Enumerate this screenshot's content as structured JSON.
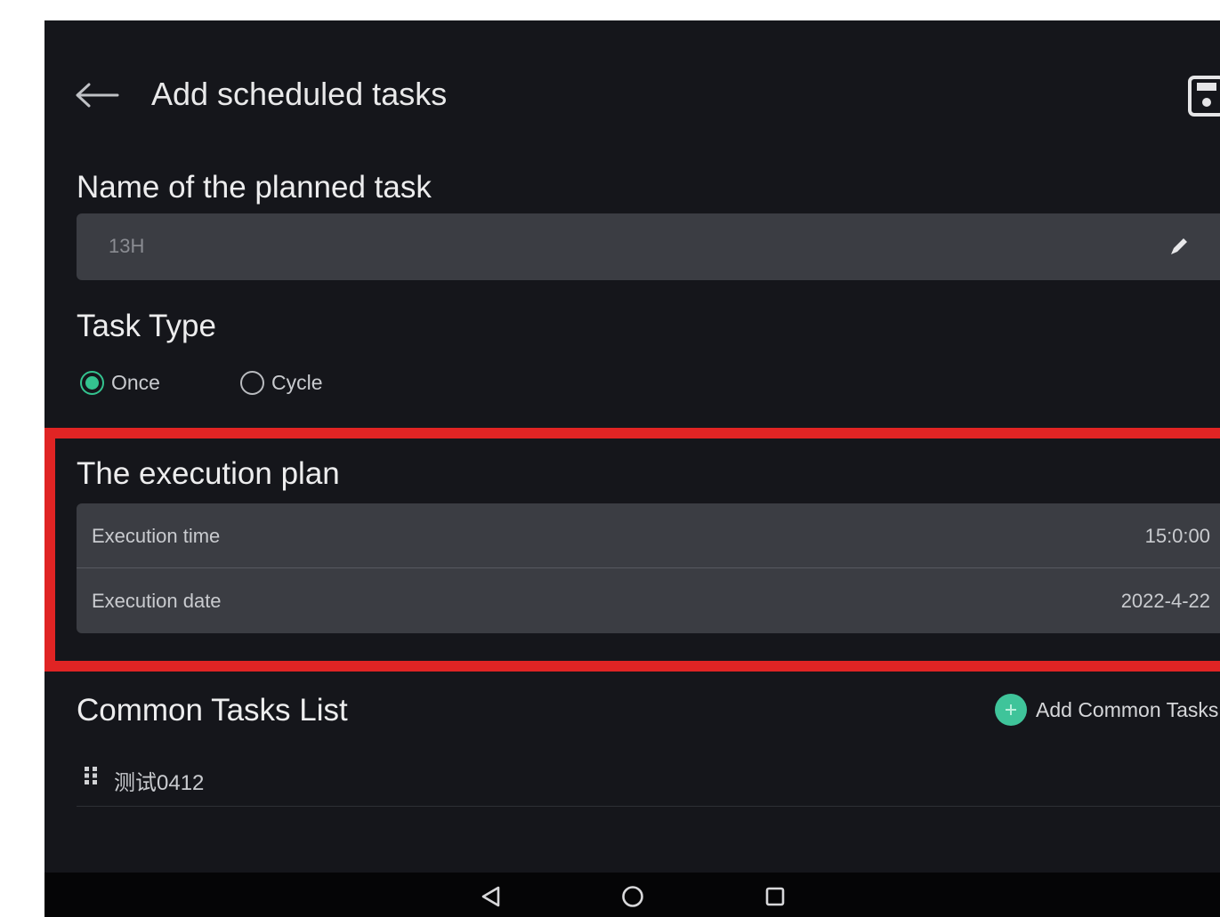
{
  "header": {
    "title": "Add scheduled tasks"
  },
  "task_name": {
    "label": "Name of the planned task",
    "value": "13H"
  },
  "task_type": {
    "label": "Task Type",
    "options": [
      {
        "label": "Once",
        "selected": true
      },
      {
        "label": "Cycle",
        "selected": false
      }
    ]
  },
  "execution_plan": {
    "label": "The execution plan",
    "rows": [
      {
        "key": "Execution time",
        "value": "15:0:00"
      },
      {
        "key": "Execution date",
        "value": "2022-4-22"
      }
    ]
  },
  "common_tasks": {
    "label": "Common Tasks List",
    "add_label": "Add Common Tasks",
    "items": [
      {
        "name": "测试0412"
      }
    ]
  },
  "colors": {
    "background": "#15161b",
    "field": "#3b3d43",
    "accent": "#34c38f",
    "highlight": "#e02424"
  }
}
